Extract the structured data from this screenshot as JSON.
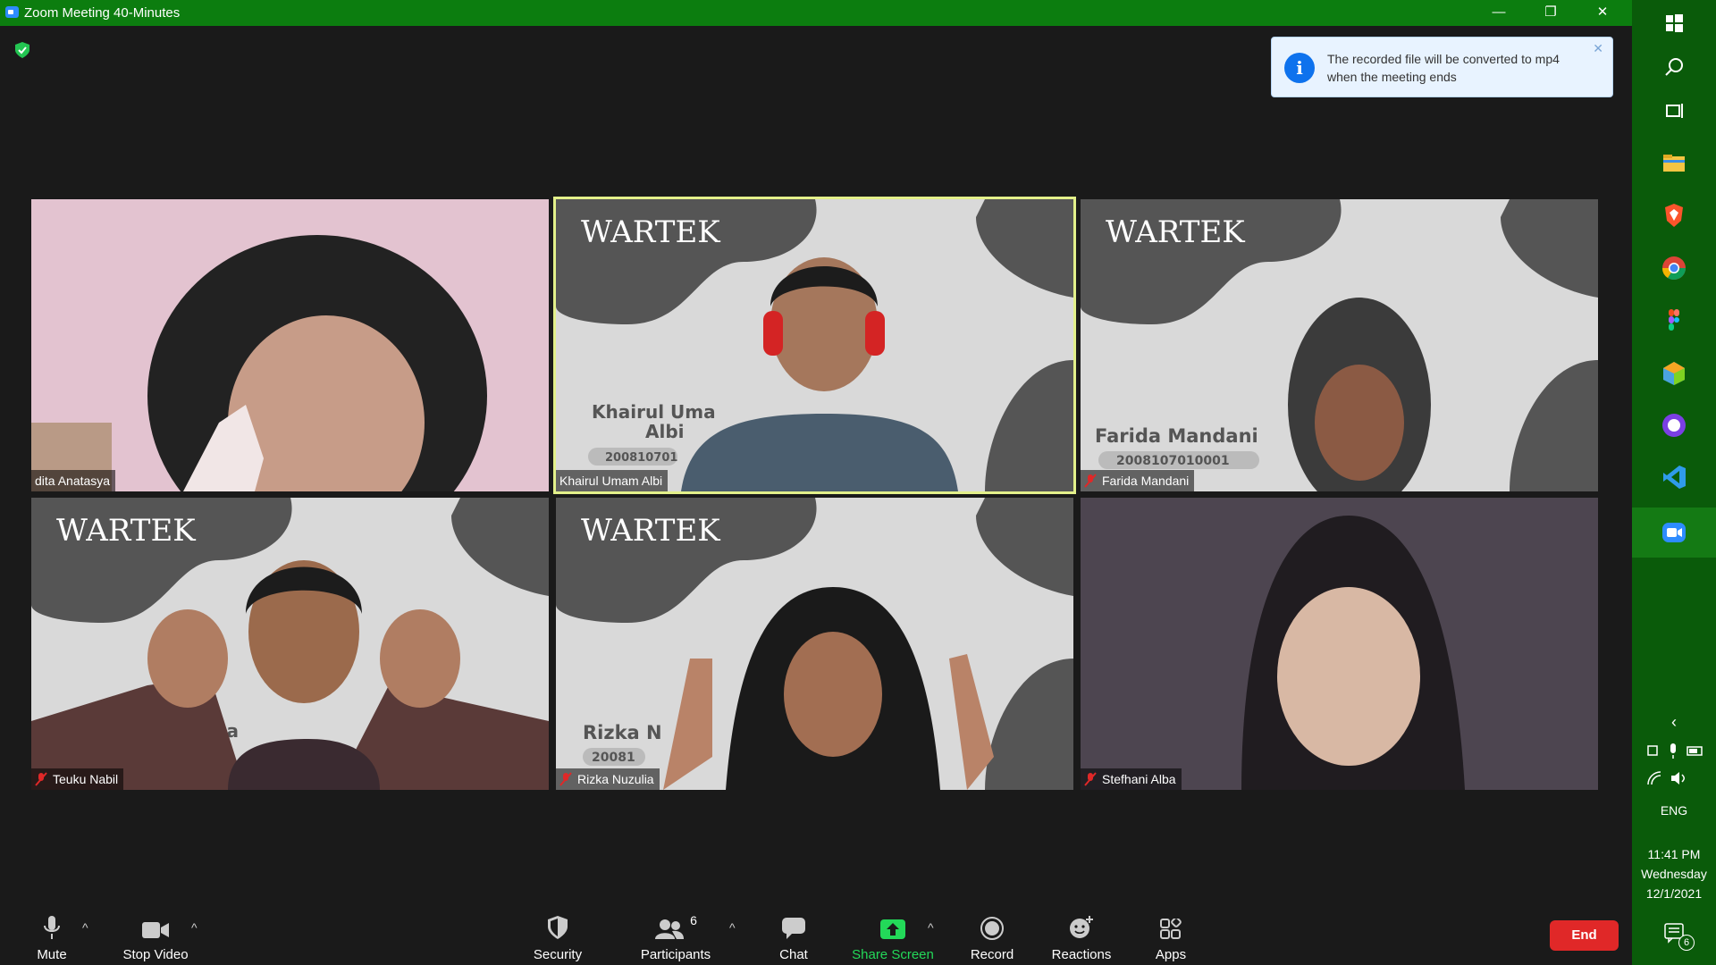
{
  "window": {
    "title": "Zoom Meeting 40-Minutes",
    "minimize": "—",
    "restore": "❐",
    "close": "✕"
  },
  "notification": {
    "text": "The recorded file will be converted to mp4 when the meeting ends",
    "icon": "info-icon",
    "close": "✕"
  },
  "participants": [
    {
      "name": "dita Anatasya",
      "muted": false,
      "active": false,
      "background": "pink-room"
    },
    {
      "name": "Khairul Umam Albi",
      "muted": false,
      "active": true,
      "background": "wartek",
      "bg_logo": "WARTEK",
      "bg_name_line1": "Khairul Uma",
      "bg_name_line2": "Albi",
      "bg_id": "200810701"
    },
    {
      "name": "Farida Mandani",
      "muted": true,
      "active": false,
      "background": "wartek",
      "bg_logo": "WARTEK",
      "bg_name_line1": "Farida Mandani",
      "bg_id": "2008107010001"
    },
    {
      "name": "Teuku Nabil",
      "muted": true,
      "active": false,
      "background": "wartek",
      "bg_logo": "WARTEK",
      "bg_name_line1": "uha"
    },
    {
      "name": "Rizka Nuzulia",
      "muted": true,
      "active": false,
      "background": "wartek",
      "bg_logo": "WARTEK",
      "bg_name_line1": "Rizka N",
      "bg_id": "20081"
    },
    {
      "name": "Stefhani Alba",
      "muted": true,
      "active": false,
      "background": "dark-room"
    }
  ],
  "toolbar": {
    "mute": "Mute",
    "stop_video": "Stop Video",
    "security": "Security",
    "participants": "Participants",
    "participants_count": "6",
    "chat": "Chat",
    "share_screen": "Share Screen",
    "record": "Record",
    "reactions": "Reactions",
    "apps": "Apps",
    "end": "End",
    "caret": "^"
  },
  "taskbar": {
    "language": "ENG",
    "time": "11:41 PM",
    "day": "Wednesday",
    "date": "12/1/2021",
    "notifications_count": "6",
    "chevron": "‹"
  },
  "colors": {
    "titlebar": "#0c7d0f",
    "taskbar": "#0a5b0a",
    "active_speaker": "#e3f08a",
    "share_green": "#23d959",
    "end_red": "#e02828"
  }
}
